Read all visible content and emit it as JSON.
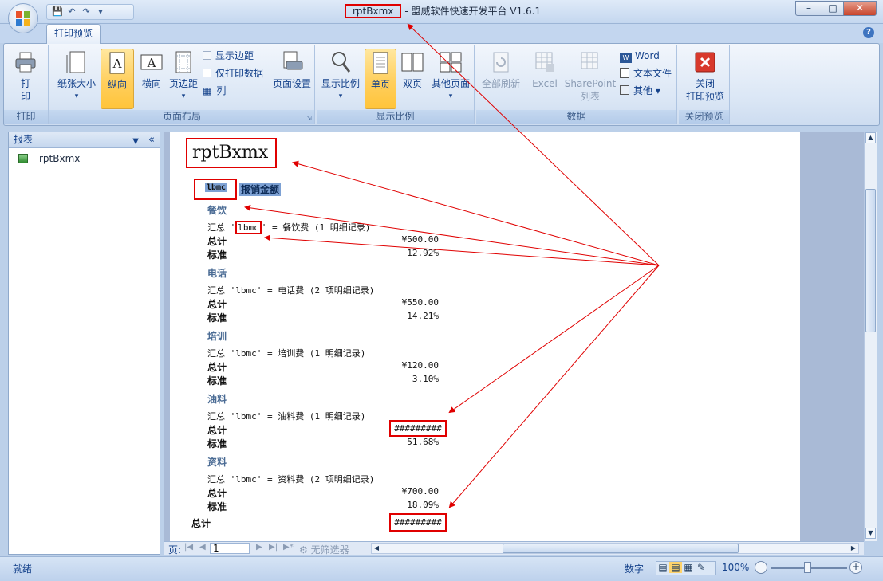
{
  "window": {
    "title_highlight": "rptBxmx",
    "title_rest": "- 盟威软件快速开发平台 V1.6.1"
  },
  "qat": {
    "save": "💾",
    "undo": "↶",
    "redo": "↷",
    "more": "▾"
  },
  "tabs": [
    {
      "label": "打印预览"
    }
  ],
  "ribbon": {
    "groups": [
      {
        "label": "打印",
        "buttons": [
          "打\n印"
        ]
      },
      {
        "label": "页面布局",
        "buttons": [
          "纸张大小",
          "纵向",
          "横向",
          "页边距"
        ],
        "checks": [
          "显示边距",
          "仅打印数据"
        ],
        "col_label": "列",
        "setup": "页面设置"
      },
      {
        "label": "显示比例",
        "buttons": [
          "显示比例",
          "单页",
          "双页",
          "其他页面"
        ]
      },
      {
        "label": "数据",
        "buttons": [
          "全部刷新",
          "Excel",
          "SharePoint\n列表"
        ],
        "links": [
          "Word",
          "文本文件",
          "其他"
        ]
      },
      {
        "label": "关闭预览",
        "buttons": [
          "关闭\n打印预览"
        ]
      }
    ],
    "selected": [
      "纵向",
      "单页"
    ],
    "accent": "#ffc43a"
  },
  "nav": {
    "title": "报表",
    "item": "rptBxmx"
  },
  "report": {
    "title": "rptBxmx",
    "col1": "lbmc",
    "col2": "报销金额",
    "groups": [
      {
        "name": "餐饮",
        "summary_prefix": "汇总 '",
        "summary_key": "lbmc",
        "summary_suffix": "' = 餐饮费 (1 明细记录)",
        "total": "¥500.00",
        "pct": "12.92%"
      },
      {
        "name": "电话",
        "summary": "汇总 'lbmc' = 电话费 (2 项明细记录)",
        "total": "¥550.00",
        "pct": "14.21%"
      },
      {
        "name": "培训",
        "summary": "汇总 'lbmc' = 培训费 (1 明细记录)",
        "total": "¥120.00",
        "pct": "3.10%"
      },
      {
        "name": "油料",
        "summary": "汇总 'lbmc' = 油料费 (1 明细记录)",
        "total": "#########",
        "pct": "51.68%"
      },
      {
        "name": "资料",
        "summary": "汇总 'lbmc' = 资料费 (2 项明细记录)",
        "total": "¥700.00",
        "pct": "18.09%"
      }
    ],
    "total_label": "总计",
    "std_label": "标准",
    "grand_total_label": "总计",
    "grand_total": "#########"
  },
  "pager": {
    "label": "页:",
    "page": "1",
    "filter": "无筛选器"
  },
  "status": {
    "left": "就绪",
    "mode": "数字",
    "zoom": "100%"
  }
}
